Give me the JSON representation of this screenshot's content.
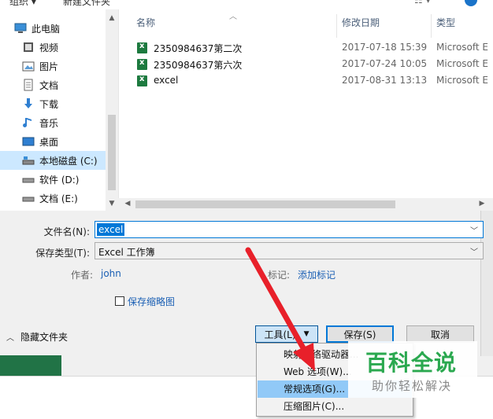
{
  "toolbar": {
    "organize": "组织 ▾",
    "new_folder": "新建文件夹"
  },
  "nav": {
    "items": [
      {
        "label": "此电脑",
        "icon": "computer-icon"
      },
      {
        "label": "视频",
        "icon": "video-icon"
      },
      {
        "label": "图片",
        "icon": "picture-icon"
      },
      {
        "label": "文档",
        "icon": "document-icon"
      },
      {
        "label": "下载",
        "icon": "download-icon"
      },
      {
        "label": "音乐",
        "icon": "music-icon"
      },
      {
        "label": "桌面",
        "icon": "desktop-icon"
      },
      {
        "label": "本地磁盘 (C:)",
        "icon": "drive-icon",
        "selected": true
      },
      {
        "label": "软件 (D:)",
        "icon": "drive-icon"
      },
      {
        "label": "文档 (E:)",
        "icon": "drive-icon"
      }
    ]
  },
  "files": {
    "headers": {
      "name": "名称",
      "date": "修改日期",
      "type": "类型"
    },
    "rows": [
      {
        "name": "2350984637第二次",
        "date": "2017-07-18 15:39",
        "type": "Microsoft E"
      },
      {
        "name": "2350984637第六次",
        "date": "2017-07-24 10:05",
        "type": "Microsoft E"
      },
      {
        "name": "excel",
        "date": "2017-08-31 13:13",
        "type": "Microsoft E"
      }
    ]
  },
  "form": {
    "filename_label": "文件名(N):",
    "filename_value": "excel",
    "savetype_label": "保存类型(T):",
    "savetype_value": "Excel 工作簿",
    "author_label": "作者:",
    "author_value": "john",
    "tags_label": "标记:",
    "tags_value": "添加标记",
    "thumbnail_label": "保存缩略图"
  },
  "footer": {
    "hide_folders": "隐藏文件夹",
    "tools_button": "工具(L)",
    "save_button": "保存(S)",
    "cancel_button": "取消"
  },
  "menu": {
    "items": [
      {
        "label": "映射网络驱动器..."
      },
      {
        "label": "Web 选项(W)..."
      },
      {
        "label": "常规选项(G)...",
        "highlighted": true
      },
      {
        "label": "压缩图片(C)..."
      }
    ]
  },
  "watermark": {
    "title": "百科全说",
    "subtitle": "助你轻松解决"
  },
  "colors": {
    "accent": "#0078d7",
    "excel_green": "#217346",
    "arrow_red": "#e8202a",
    "watermark_green": "#2aa84f"
  }
}
